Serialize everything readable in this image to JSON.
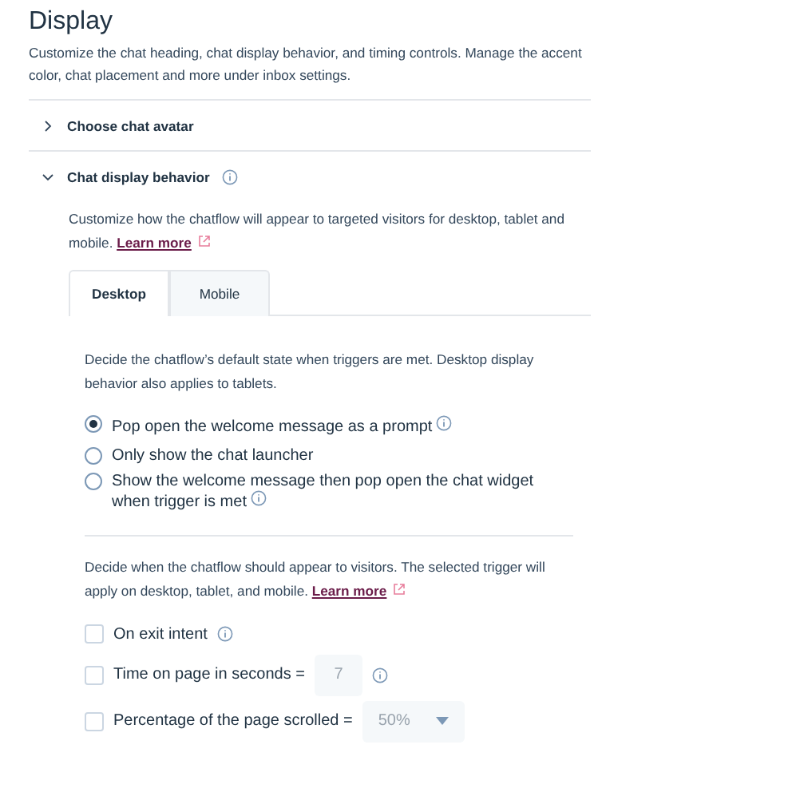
{
  "title": "Display",
  "description": "Customize the chat heading, chat display behavior, and timing controls. Manage the accent color, chat placement and more under inbox settings.",
  "sections": [
    {
      "label": "Choose chat avatar",
      "expanded": false,
      "info": false
    },
    {
      "label": "Chat display behavior",
      "expanded": true,
      "info": true
    }
  ],
  "display_behavior": {
    "intro": "Customize how the chatflow will appear to targeted visitors for desktop, tablet and mobile.",
    "intro_link": "Learn more",
    "tabs": [
      {
        "label": "Desktop",
        "selected": true
      },
      {
        "label": "Mobile",
        "selected": false
      }
    ],
    "state_text": "Decide the chatflow’s default state when triggers are met. Desktop display behavior also applies to tablets.",
    "options": [
      {
        "label": "Pop open the welcome message as a prompt",
        "selected": true,
        "info": true
      },
      {
        "label": "Only show the chat launcher",
        "selected": false,
        "info": false
      },
      {
        "label": "Show the welcome message then pop open the chat widget when trigger is met",
        "selected": false,
        "info": true
      }
    ],
    "trigger_text": "Decide when the chatflow should appear to visitors. The selected trigger will apply on desktop, tablet, and mobile.",
    "trigger_link": "Learn more",
    "triggers": [
      {
        "kind": "plain",
        "label": "On exit intent",
        "checked": false,
        "info": true
      },
      {
        "kind": "number",
        "label": "Time on page in seconds =",
        "checked": false,
        "value": "7",
        "info": true
      },
      {
        "kind": "select",
        "label": "Percentage of the page scrolled =",
        "checked": false,
        "value": "50%",
        "info": false
      }
    ]
  }
}
